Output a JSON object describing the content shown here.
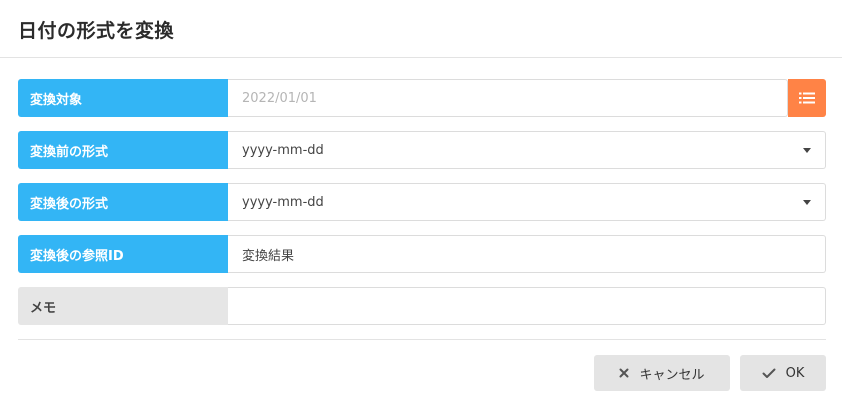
{
  "dialog": {
    "title": "日付の形式を変換"
  },
  "form": {
    "rows": [
      {
        "label": "変換対象",
        "placeholder": "2022/01/01"
      },
      {
        "label": "変換前の形式",
        "value": "yyyy-mm-dd"
      },
      {
        "label": "変換後の形式",
        "value": "yyyy-mm-dd"
      },
      {
        "label": "変換後の参照ID",
        "value": "変換結果"
      },
      {
        "label": "メモ",
        "value": ""
      }
    ]
  },
  "footer": {
    "cancel_label": "キャンセル",
    "ok_label": "OK"
  },
  "colors": {
    "label_blue": "#33b5f5",
    "label_gray": "#e6e6e6",
    "list_button": "#ff8346",
    "button_gray": "#e4e4e4"
  },
  "icons": {
    "list_button": "list-icon",
    "dropdowns": "caret-down-icon",
    "cancel": "close-icon",
    "ok": "check-icon"
  }
}
